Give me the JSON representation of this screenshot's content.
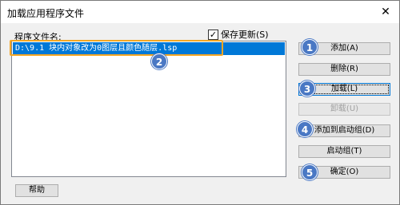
{
  "window": {
    "title": "加载应用程序文件",
    "close_glyph": "✕"
  },
  "file_list": {
    "label": "程序文件名:",
    "items": [
      {
        "path": "D:\\9.1                    块内对象改为0图层且颜色随层.lsp"
      }
    ]
  },
  "save_changes": {
    "label": "保存更新(S)",
    "checked": true,
    "check_glyph": "✓"
  },
  "buttons": {
    "add": "添加(A)",
    "remove": "删除(R)",
    "load": "加载(L)",
    "unload": "卸载(U)",
    "add_to_startup": "添加到启动组(D)",
    "startup_group": "启动组(T)",
    "ok": "确定(O)",
    "help": "帮助"
  },
  "markers": [
    "1",
    "2",
    "3",
    "4",
    "5"
  ],
  "colors": {
    "selection": "#0078d7",
    "marker": "#4a78c4",
    "focus_outline": "#f5a623"
  }
}
